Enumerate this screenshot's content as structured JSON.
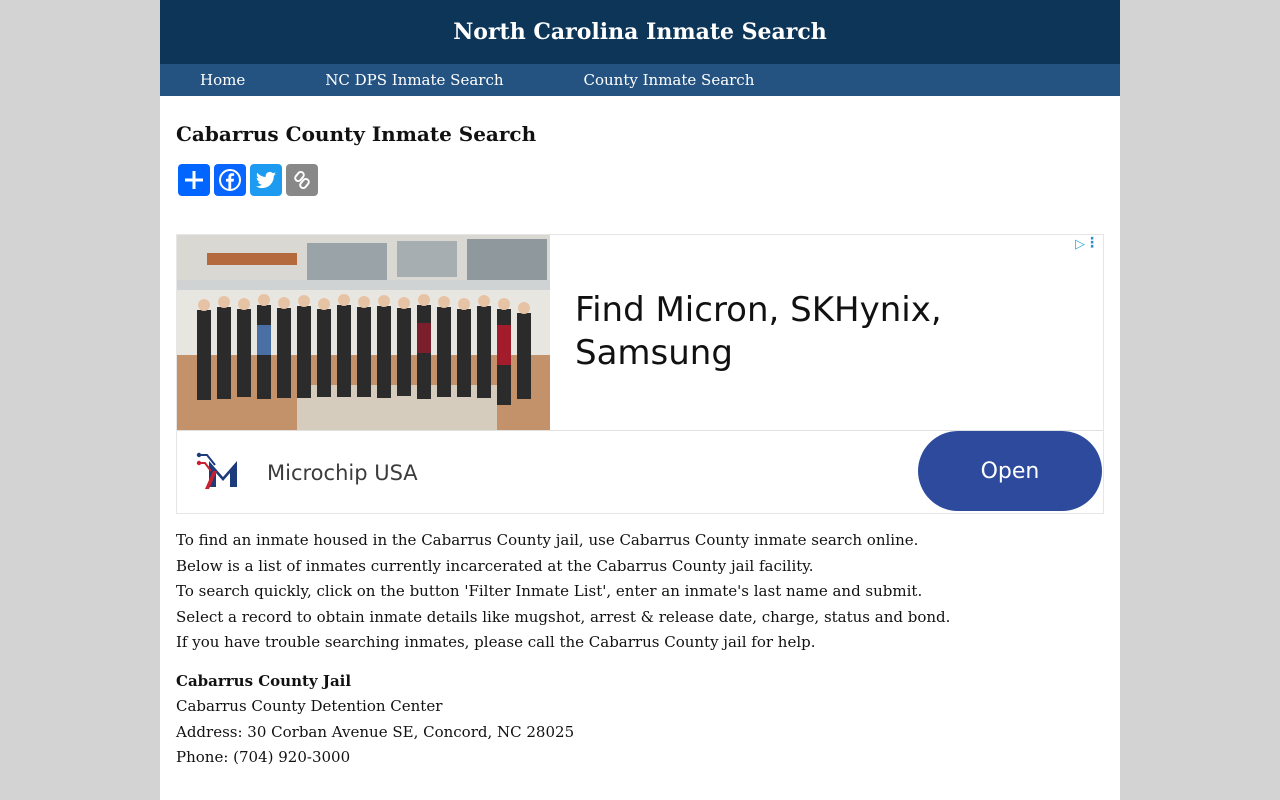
{
  "header": {
    "title": "North Carolina Inmate Search"
  },
  "nav": {
    "home": "Home",
    "dps": "NC DPS Inmate Search",
    "county": "County Inmate Search"
  },
  "main": {
    "title": "Cabarrus County Inmate Search"
  },
  "share": {
    "buttons": [
      {
        "icon": "plus-icon",
        "color": "#0166ff"
      },
      {
        "icon": "facebook-icon",
        "color": "#0866ff"
      },
      {
        "icon": "twitter-icon",
        "color": "#1d9bf0"
      },
      {
        "icon": "copy-link-icon",
        "color": "#888888"
      }
    ]
  },
  "ad": {
    "headline": "Find Micron, SKHynix, Samsung",
    "brand": "Microchip USA",
    "cta": "Open",
    "cta_color": "#2e4a9d"
  },
  "intro": {
    "line1": "To find an inmate housed in the Cabarrus County jail, use Cabarrus County inmate search online.",
    "line2": "Below is a list of inmates currently incarcerated at the Cabarrus County jail facility.",
    "line3": "To search quickly, click on the button 'Filter Inmate List', enter an inmate's last name and submit.",
    "line4": "Select a record to obtain inmate details like mugshot, arrest & release date, charge, status and bond.",
    "line5": "If you have trouble searching inmates, please call the Cabarrus County jail for help."
  },
  "jail": {
    "name": "Cabarrus County Jail",
    "facility": "Cabarrus County Detention Center",
    "address": "Address: 30 Corban Avenue SE, Concord, NC 28025",
    "phone": "Phone: (704) 920-3000"
  },
  "colors": {
    "header_bg": "#0c3558",
    "nav_bg": "#245381",
    "page_bg": "#d3d3d3"
  }
}
